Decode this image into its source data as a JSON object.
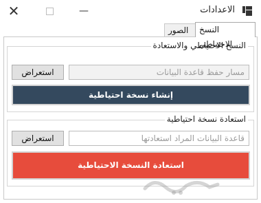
{
  "window": {
    "title": "الاعدادات",
    "controls": {
      "close": "✕",
      "minimize": "—"
    }
  },
  "tabs": [
    {
      "label": "النسخ الاحتياطي",
      "active": true
    },
    {
      "label": "الصور",
      "active": false
    }
  ],
  "backup_group": {
    "title": "النسخ الاحتياطي والاستعادة",
    "path_placeholder": "مسار حفظ قاعدة البيانات",
    "browse_label": "استعراض",
    "create_label": "إنشاء نسخة احتياطية"
  },
  "restore_group": {
    "title": "استعادة نسخة احتياطية",
    "path_placeholder": "قاعدة البيانات المراد استعادتها",
    "browse_label": "استعراض",
    "restore_label": "استعادة النسخة الاحتياطية"
  },
  "colors": {
    "create_button": "#34495e",
    "restore_button": "#e74c3c"
  },
  "icons": [
    "app-icon",
    "close-icon",
    "maximize-icon",
    "minimize-icon"
  ]
}
